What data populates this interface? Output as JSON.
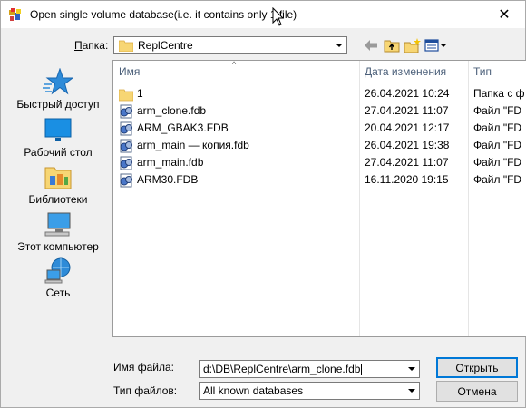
{
  "window": {
    "title": "Open single volume database(i.e. it contains only 1 file)",
    "close_glyph": "✕"
  },
  "lookin": {
    "label": "Папка:",
    "value": "ReplCentre"
  },
  "places": [
    {
      "label": "Быстрый доступ",
      "icon": "star-icon"
    },
    {
      "label": "Рабочий стол",
      "icon": "desktop-icon"
    },
    {
      "label": "Библиотеки",
      "icon": "libraries-icon"
    },
    {
      "label": "Этот компьютер",
      "icon": "computer-icon"
    },
    {
      "label": "Сеть",
      "icon": "network-icon"
    }
  ],
  "columns": {
    "name": "Имя",
    "date": "Дата изменения",
    "type": "Тип"
  },
  "files": [
    {
      "name": "1",
      "date": "26.04.2021 10:24",
      "type": "Папка с ф",
      "icon": "folder-icon"
    },
    {
      "name": "arm_clone.fdb",
      "date": "27.04.2021 11:07",
      "type": "Файл \"FD",
      "icon": "database-file-icon"
    },
    {
      "name": "ARM_GBAK3.FDB",
      "date": "20.04.2021 12:17",
      "type": "Файл \"FD",
      "icon": "database-file-icon"
    },
    {
      "name": "arm_main — копия.fdb",
      "date": "26.04.2021 19:38",
      "type": "Файл \"FD",
      "icon": "database-file-icon"
    },
    {
      "name": "arm_main.fdb",
      "date": "27.04.2021 11:07",
      "type": "Файл \"FD",
      "icon": "database-file-icon"
    },
    {
      "name": "ARM30.FDB",
      "date": "16.11.2020 19:15",
      "type": "Файл \"FD",
      "icon": "database-file-icon"
    }
  ],
  "filename": {
    "label": "Имя файла:",
    "value": "d:\\DB\\ReplCentre\\arm_clone.fdb"
  },
  "filetype": {
    "label": "Тип файлов:",
    "value": "All known databases"
  },
  "buttons": {
    "open": "Открыть",
    "cancel": "Отмена"
  },
  "colors": {
    "accent": "#0078d7",
    "header_text": "#4c607a"
  }
}
